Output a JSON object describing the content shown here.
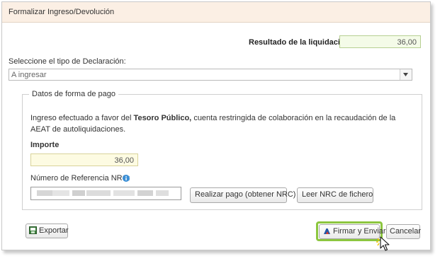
{
  "dialog": {
    "title": "Formalizar Ingreso/Devolución"
  },
  "result": {
    "label": "Resultado de la liquidación",
    "value": "36,00"
  },
  "declaration": {
    "label": "Seleccione el tipo de Declaración:",
    "selected": "A ingresar"
  },
  "payment": {
    "legend": "Datos de forma de pago",
    "info_pre": "Ingreso efectuado a favor del",
    "info_bold": "Tesoro Público,",
    "info_post": "cuenta restringida de colaboración en la recaudación de la AEAT de autoliquidaciones.",
    "importe_label": "Importe",
    "importe_value": "36,00",
    "nrc_label": "Número de Referencia NRC:",
    "pay_button": "Realizar pago (obtener NRC)",
    "read_button": "Leer NRC de fichero"
  },
  "footer": {
    "export_button": "Exportar",
    "sign_button": "Firmar y Enviar",
    "cancel_button": "Cancelar"
  },
  "colors": {
    "title_bg": "#fbefe4",
    "result_bg": "#f4fbe8",
    "importe_bg": "#fdfbe2",
    "highlight": "#8cc63f",
    "info_icon": "#3b8fd6"
  }
}
